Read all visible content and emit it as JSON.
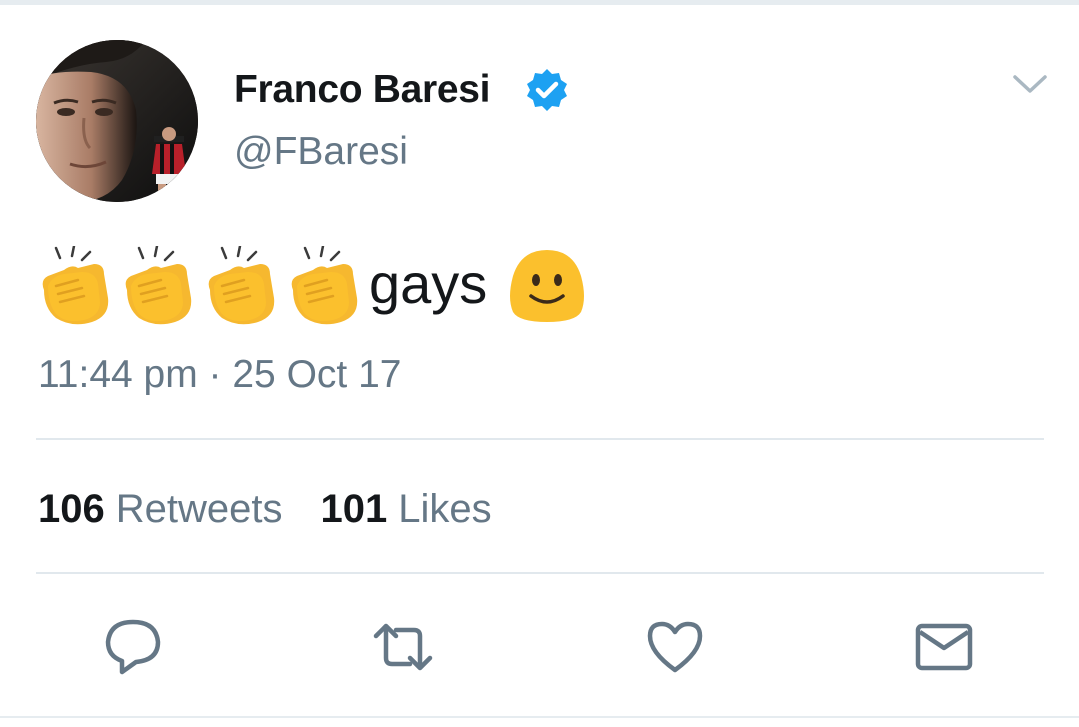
{
  "tweet": {
    "author": {
      "display_name": "Franco Baresi",
      "handle": "@FBaresi",
      "verified": true,
      "verified_color": "#1da1f2"
    },
    "body": {
      "emoji_prefix": [
        "clapping-hands",
        "clapping-hands",
        "clapping-hands",
        "clapping-hands"
      ],
      "text": "gays",
      "emoji_suffix": "slightly-smiling-face"
    },
    "timestamp": "11:44 pm · 25 Oct 17",
    "stats": {
      "retweets_count": "106",
      "retweets_label": "Retweets",
      "likes_count": "101",
      "likes_label": "Likes"
    },
    "actions": [
      "reply-icon",
      "retweet-icon",
      "like-icon",
      "direct-message-icon"
    ],
    "colors": {
      "text_primary": "#14171a",
      "text_secondary": "#657786",
      "icon_gray": "#657786",
      "divider": "#e1e8ed",
      "emoji_yellow": "#fbc02d"
    }
  }
}
